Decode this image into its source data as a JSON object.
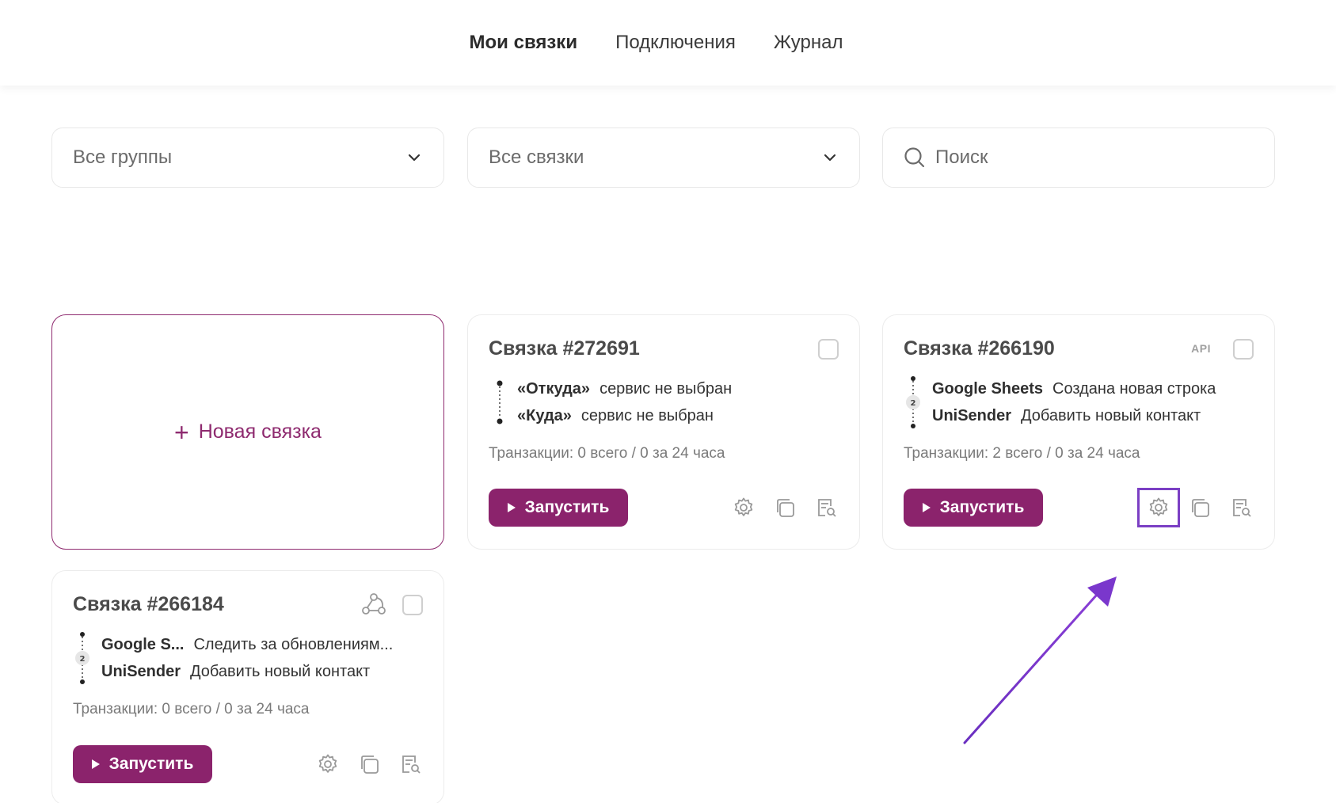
{
  "nav": {
    "tabs": [
      {
        "label": "Мои связки",
        "active": true
      },
      {
        "label": "Подключения",
        "active": false
      },
      {
        "label": "Журнал",
        "active": false
      }
    ]
  },
  "filters": {
    "groups": "Все группы",
    "links": "Все связки",
    "search_placeholder": "Поиск"
  },
  "new_card": {
    "label": "Новая связка"
  },
  "cards": [
    {
      "title": "Связка #272691",
      "steps": [
        {
          "service": "«Откуда»",
          "action": "сервис не выбран"
        },
        {
          "service": "«Куда»",
          "action": "сервис не выбран"
        }
      ],
      "transactions": "Транзакции: 0 всего / 0 за 24 часа",
      "run_label": "Запустить"
    },
    {
      "title": "Связка #266190",
      "badge": "API",
      "step_count": "2",
      "steps": [
        {
          "service": "Google Sheets",
          "action": "Создана новая строка"
        },
        {
          "service": "UniSender",
          "action": "Добавить новый контакт"
        }
      ],
      "transactions": "Транзакции: 2 всего / 0 за 24 часа",
      "run_label": "Запустить"
    },
    {
      "title": "Связка #266184",
      "step_count": "2",
      "steps": [
        {
          "service": "Google S...",
          "action": "Следить за обновлениям..."
        },
        {
          "service": "UniSender",
          "action": "Добавить новый контакт"
        }
      ],
      "transactions": "Транзакции: 0 всего / 0 за 24 часа",
      "run_label": "Запустить"
    }
  ],
  "colors": {
    "accent": "#8b236c",
    "highlight": "#7b3fc4"
  },
  "icons": [
    "chevron-down-icon",
    "search-icon",
    "plus-icon",
    "play-icon",
    "gear-icon",
    "copy-icon",
    "log-icon",
    "webhook-icon"
  ]
}
